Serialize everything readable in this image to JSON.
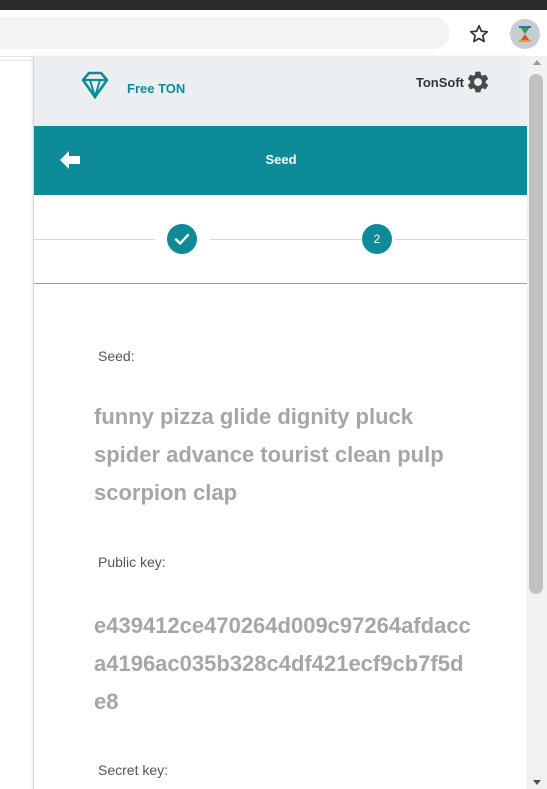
{
  "colors": {
    "accent": "#0e8b99",
    "header_background": "#eceff1",
    "value_text": "#a6a6a6"
  },
  "browser": {
    "star_icon": "star-icon",
    "extension_icon": "extension-icon"
  },
  "header": {
    "logo_icon": "diamond-icon",
    "brand": "Free TON",
    "account_name": "TonSoft",
    "settings_icon": "gear-icon"
  },
  "titlebar": {
    "back_icon": "arrow-left-icon",
    "title": "Seed"
  },
  "stepper": {
    "steps": [
      {
        "state": "completed",
        "icon": "check-icon"
      },
      {
        "state": "current",
        "label": "2"
      }
    ]
  },
  "content": {
    "seed_label": "Seed:",
    "seed_value": "funny pizza glide dignity pluck spider advance tourist clean pulp scorpion clap",
    "public_key_label": "Public key:",
    "public_key_value": "e439412ce470264d009c97264afdacca4196ac035b328c4df421ecf9cb7f5de8",
    "secret_key_label": "Secret key:"
  }
}
